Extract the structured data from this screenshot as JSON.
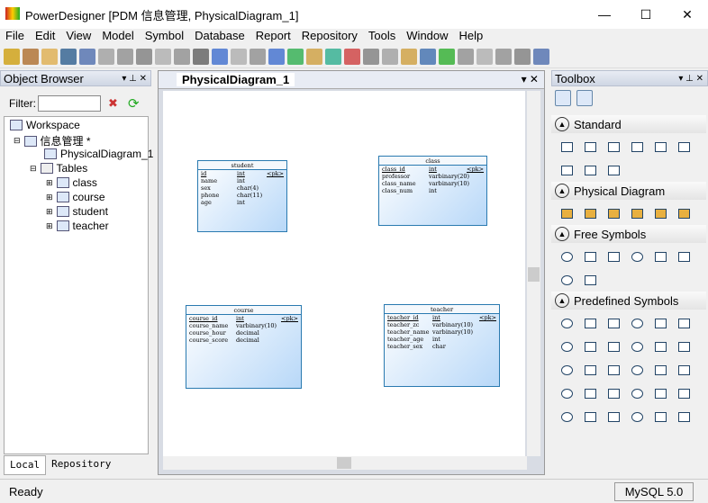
{
  "app": {
    "title": "PowerDesigner [PDM 信息管理, PhysicalDiagram_1]"
  },
  "menu": [
    "File",
    "Edit",
    "View",
    "Model",
    "Symbol",
    "Database",
    "Report",
    "Repository",
    "Tools",
    "Window",
    "Help"
  ],
  "object_browser": {
    "title": "Object Browser",
    "filter_label": "Filter:",
    "filter_value": "",
    "tree": {
      "workspace": "Workspace",
      "model": "信息管理 *",
      "diagram": "PhysicalDiagram_1",
      "tables_folder": "Tables",
      "tables": [
        "class",
        "course",
        "student",
        "teacher"
      ]
    },
    "tabs": [
      "Local",
      "Repository"
    ]
  },
  "diagram": {
    "tab": "PhysicalDiagram_1",
    "tables": [
      {
        "name": "student",
        "cols": [
          [
            "id",
            "int",
            true
          ],
          [
            "name",
            "int",
            false
          ],
          [
            "sex",
            "char(4)",
            false
          ],
          [
            "phone",
            "char(11)",
            false
          ],
          [
            "age",
            "int",
            false
          ]
        ]
      },
      {
        "name": "class",
        "cols": [
          [
            "class_id",
            "int",
            true
          ],
          [
            "professor",
            "varbinary(20)",
            false
          ],
          [
            "class_name",
            "varbinary(10)",
            false
          ],
          [
            "class_num",
            "int",
            false
          ]
        ]
      },
      {
        "name": "course",
        "cols": [
          [
            "course_id",
            "int",
            true
          ],
          [
            "course_name",
            "varbinary(10)",
            false
          ],
          [
            "course_hour",
            "decimal",
            false
          ],
          [
            "course_score",
            "decimal",
            false
          ]
        ]
      },
      {
        "name": "teacher",
        "cols": [
          [
            "teacher_id",
            "int",
            true
          ],
          [
            "teacher_zc",
            "varbinary(10)",
            false
          ],
          [
            "teacher_name",
            "varbinary(10)",
            false
          ],
          [
            "teacher_age",
            "int",
            false
          ],
          [
            "teacher_sex",
            "char",
            false
          ]
        ]
      }
    ],
    "pk_label": "<pk>"
  },
  "toolbox": {
    "title": "Toolbox",
    "sections": [
      "Standard",
      "Physical Diagram",
      "Free Symbols",
      "Predefined Symbols"
    ]
  },
  "status": {
    "text": "Ready",
    "dbms": "MySQL 5.0"
  },
  "colors": {
    "table_border": "#2a7ab0",
    "table_fill": "#b8d8f8"
  }
}
